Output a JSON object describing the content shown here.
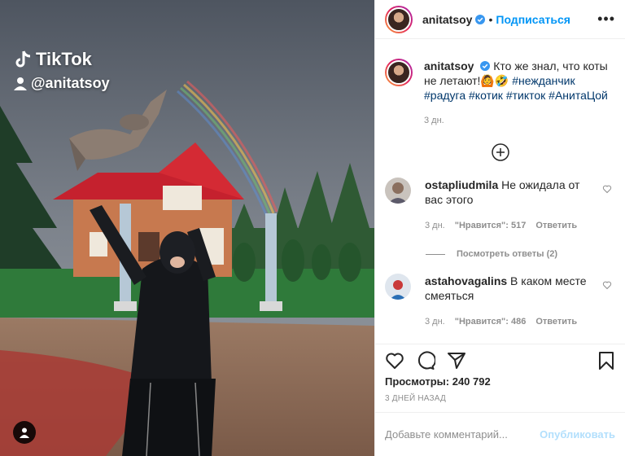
{
  "media": {
    "tiktok_label": "TikTok",
    "tiktok_handle": "@anitatsoy",
    "icons": {
      "tiktok": "tiktok-logo-icon",
      "person": "person-icon",
      "tag": "user-tag-icon"
    }
  },
  "header": {
    "username": "anitatsoy",
    "follow_label": "Подписаться",
    "separator": "•",
    "more_label": "•••"
  },
  "caption": {
    "username": "anitatsoy",
    "text": "Кто же знал, что коты не летают!🙆🤣",
    "hashtags": [
      "#нежданчик",
      "#радуга",
      "#котик",
      "#тикток",
      "#АнитаЦой"
    ],
    "time": "3 дн."
  },
  "comments": [
    {
      "username": "ostapliudmila",
      "text": "Не ожидала от вас этого",
      "time": "3 дн.",
      "likes": "\"Нравится\": 517",
      "reply_label": "Ответить",
      "view_replies": "Посмотреть ответы (2)"
    },
    {
      "username": "astahovagalins",
      "text": "В каком месте смеяться",
      "time": "3 дн.",
      "likes": "\"Нравится\": 486",
      "reply_label": "Ответить"
    }
  ],
  "stats": {
    "views_label": "Просмотры:",
    "views_value": "240 792",
    "date": "3 ДНЕЙ НАЗАД"
  },
  "composer": {
    "placeholder": "Добавьте комментарий...",
    "publish_label": "Опубликовать"
  },
  "colors": {
    "accent": "#0095f6",
    "hashtag": "#00376b",
    "muted": "#8e8e8e",
    "publish_disabled": "#b2dffc"
  }
}
